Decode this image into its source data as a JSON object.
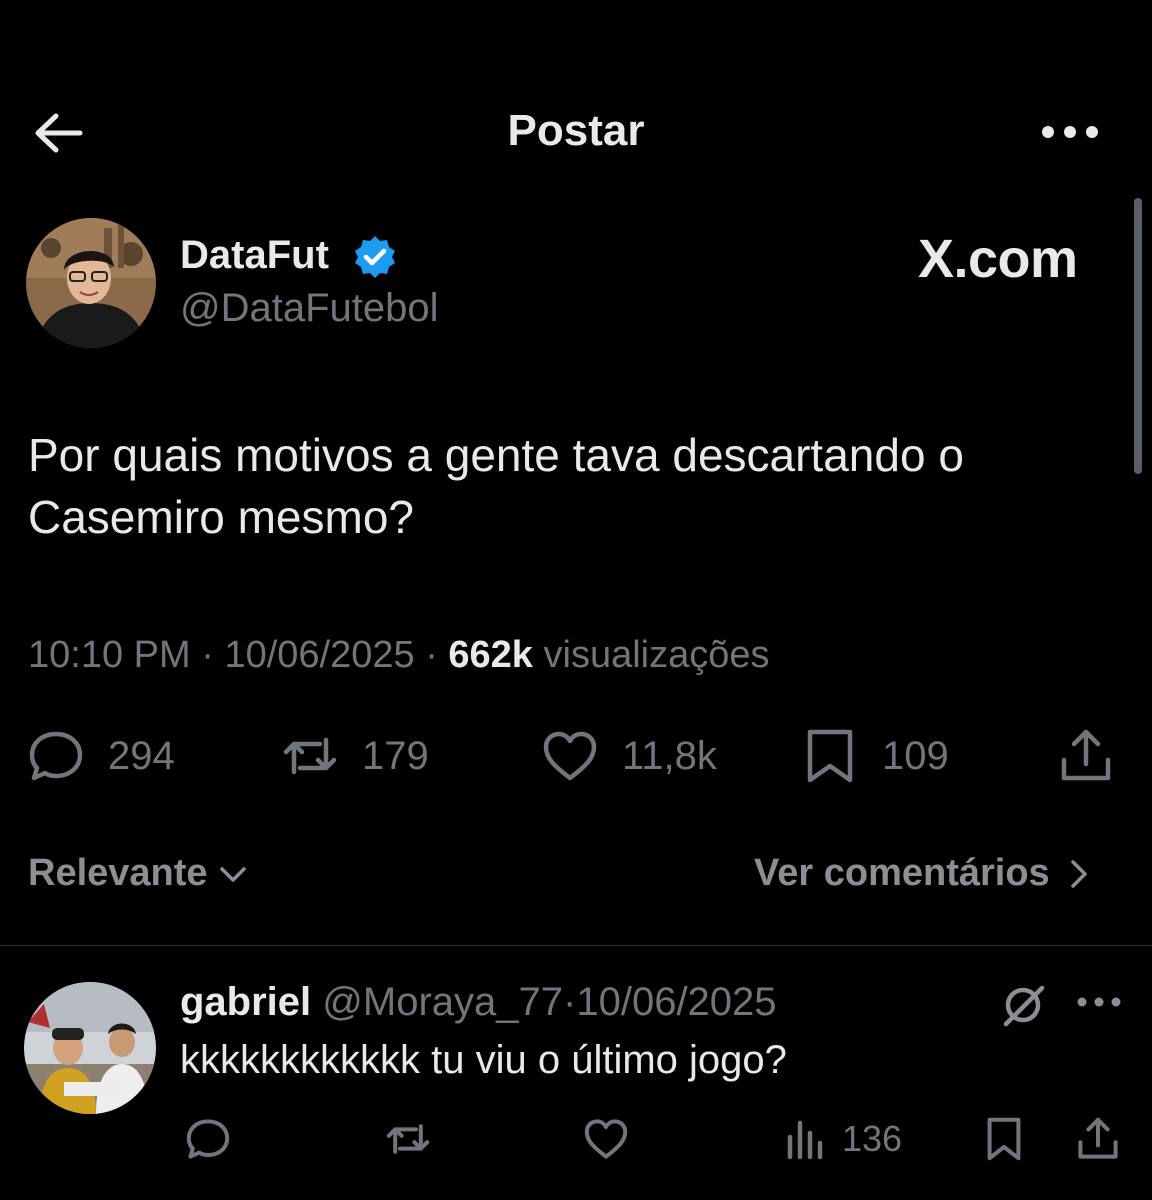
{
  "header": {
    "title": "Postar"
  },
  "author": {
    "name": "DataFut",
    "handle": "@DataFutebol"
  },
  "watermark": "X.com",
  "tweet": {
    "text": "Por quais motivos a gente tava descartando o Casemiro mesmo?",
    "time": "10:10 PM",
    "date": "10/06/2025",
    "views": "662k",
    "views_label": "visualizações",
    "sep": "·"
  },
  "stats": {
    "replies": "294",
    "retweets": "179",
    "likes": "11,8k",
    "bookmarks": "109"
  },
  "sort": {
    "label": "Relevante"
  },
  "see_comments": {
    "label": "Ver comentários"
  },
  "reply": {
    "name": "gabriel",
    "handle": "@Moraya_77",
    "sep": "·",
    "date": "10/06/2025",
    "text": "kkkkkkkkkkkk tu viu o último jogo?",
    "views": "136"
  },
  "colors": {
    "background": "#000000",
    "text": "#e7e9ea",
    "muted": "#71767b",
    "verified": "#1d9bf0"
  }
}
